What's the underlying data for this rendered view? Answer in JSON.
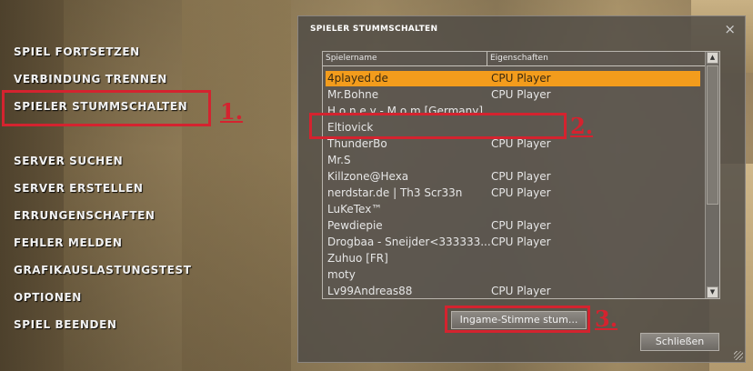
{
  "menu": {
    "items": [
      {
        "label": "SPIEL FORTSETZEN"
      },
      {
        "label": "VERBINDUNG TRENNEN"
      },
      {
        "label": "SPIELER STUMMSCHALTEN"
      },
      {
        "label": "SERVER SUCHEN"
      },
      {
        "label": "SERVER ERSTELLEN"
      },
      {
        "label": "ERRUNGENSCHAFTEN"
      },
      {
        "label": "FEHLER MELDEN"
      },
      {
        "label": "GRAFIKAUSLASTUNGSTEST"
      },
      {
        "label": "OPTIONEN"
      },
      {
        "label": "SPIEL BEENDEN"
      }
    ]
  },
  "annotations": {
    "step1": "1.",
    "step2": "2.",
    "step3": "3.",
    "color": "#d4232f"
  },
  "dialog": {
    "title": "SPIELER STUMMSCHALTEN",
    "close_icon": "×",
    "columns": {
      "name": "Spielername",
      "properties": "Eigenschaften"
    },
    "rows": [
      {
        "name": "4played.de",
        "prop": "CPU Player",
        "selected": true
      },
      {
        "name": "Mr.Bohne",
        "prop": "CPU Player"
      },
      {
        "name": "H o n e y - M o m [Germany]",
        "prop": ""
      },
      {
        "name": "Eltiovick",
        "prop": ""
      },
      {
        "name": "ThunderBo",
        "prop": "CPU Player"
      },
      {
        "name": "Mr.S",
        "prop": ""
      },
      {
        "name": "Killzone@Hexa",
        "prop": "CPU Player"
      },
      {
        "name": "nerdstar.de | Th3 Scr33n",
        "prop": "CPU Player"
      },
      {
        "name": "LuKeTex™",
        "prop": ""
      },
      {
        "name": "Pewdiepie",
        "prop": "CPU Player"
      },
      {
        "name": "Drogbaa - Sneijder<333333...",
        "prop": "CPU Player"
      },
      {
        "name": "Zuhuo [FR]",
        "prop": ""
      },
      {
        "name": "moty",
        "prop": ""
      },
      {
        "name": "Lv99Andreas88",
        "prop": "CPU Player"
      }
    ],
    "mute_button": "Ingame-Stimme stum...",
    "close_button": "Schließen",
    "selected_color": "#f39c1c"
  }
}
